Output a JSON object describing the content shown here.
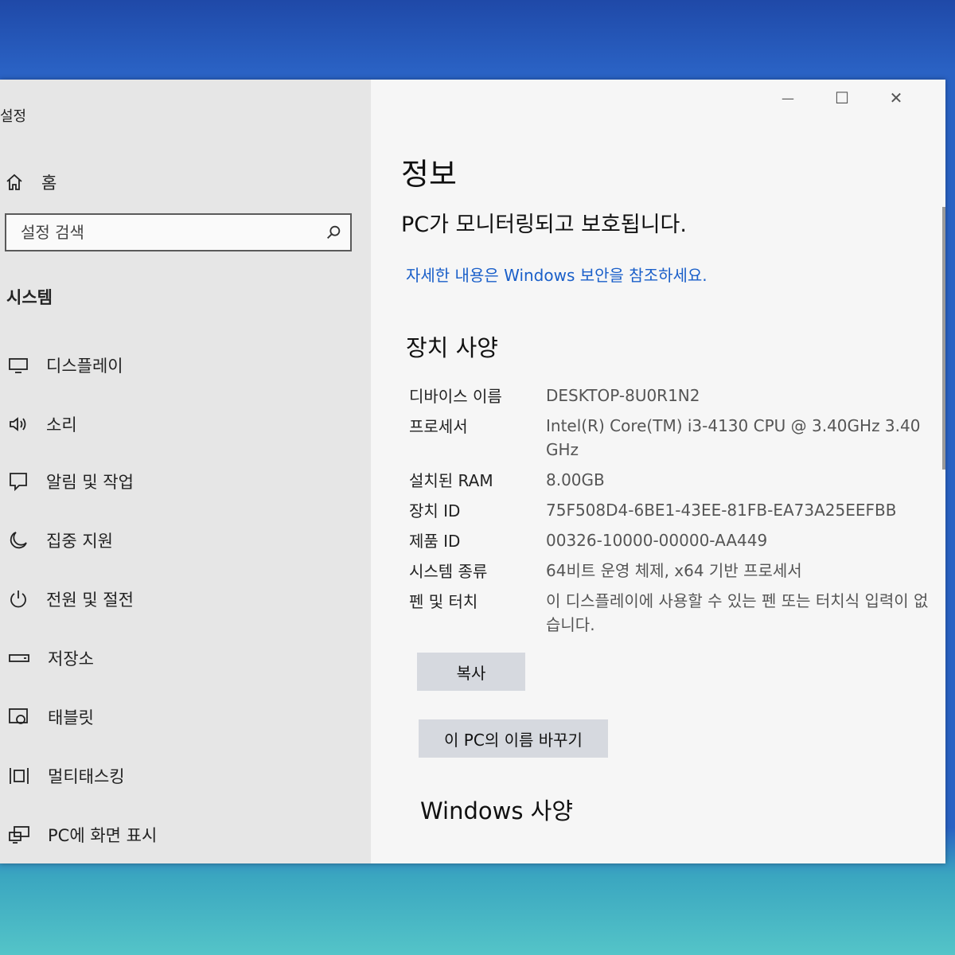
{
  "window": {
    "app_title": "설정",
    "controls": {
      "minimize": "—",
      "maximize": "☐",
      "close": "✕"
    }
  },
  "sidebar": {
    "home_label": "홈",
    "search_placeholder": "설정 검색",
    "section_label": "시스템",
    "items": [
      {
        "label": "디스플레이",
        "icon": "monitor-icon"
      },
      {
        "label": "소리",
        "icon": "speaker-icon"
      },
      {
        "label": "알림 및 작업",
        "icon": "notification-icon"
      },
      {
        "label": "집중 지원",
        "icon": "moon-icon"
      },
      {
        "label": "전원 및 절전",
        "icon": "power-icon"
      },
      {
        "label": "저장소",
        "icon": "storage-icon"
      },
      {
        "label": "태블릿",
        "icon": "tablet-icon"
      },
      {
        "label": "멀티태스킹",
        "icon": "multitasking-icon"
      },
      {
        "label": "PC에 화면 표시",
        "icon": "project-icon"
      }
    ]
  },
  "main": {
    "page_title": "정보",
    "protection_status": "PC가 모니터링되고 보호됩니다.",
    "security_link": "자세한 내용은 Windows 보안을 참조하세요.",
    "device_specs_heading": "장치 사양",
    "specs": [
      {
        "label": "디바이스 이름",
        "value": "DESKTOP-8U0R1N2"
      },
      {
        "label": "프로세서",
        "value": "Intel(R) Core(TM) i3-4130 CPU @ 3.40GHz   3.40 GHz"
      },
      {
        "label": "설치된 RAM",
        "value": "8.00GB"
      },
      {
        "label": "장치 ID",
        "value": "75F508D4-6BE1-43EE-81FB-EA73A25EEFBB"
      },
      {
        "label": "제품 ID",
        "value": "00326-10000-00000-AA449"
      },
      {
        "label": "시스템 종류",
        "value": "64비트 운영 체제, x64 기반 프로세서"
      },
      {
        "label": "펜 및 터치",
        "value": "이 디스플레이에 사용할 수 있는 펜 또는 터치식 입력이 없습니다."
      }
    ],
    "copy_button": "복사",
    "rename_button": "이 PC의 이름 바꾸기",
    "windows_specs_heading": "Windows 사양"
  },
  "colors": {
    "link": "#1a5fc9",
    "button_bg": "#d6d9df",
    "sidebar_bg": "#e6e6e6"
  }
}
